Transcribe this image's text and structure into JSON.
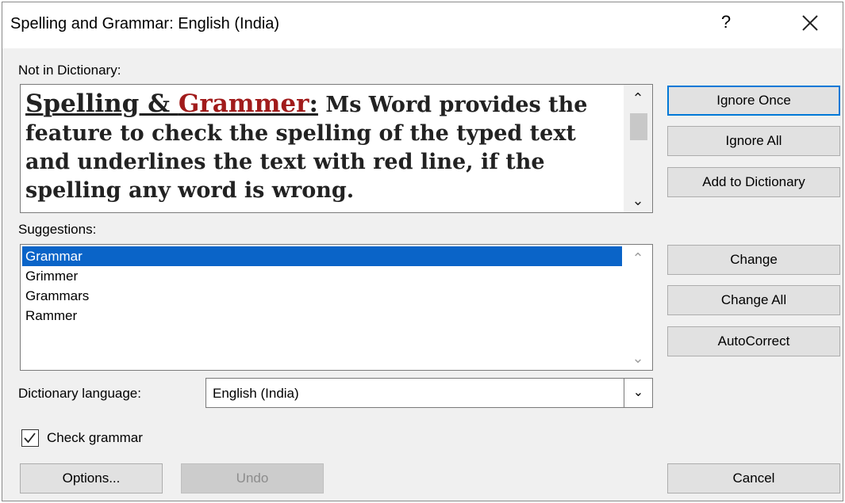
{
  "window": {
    "title": "Spelling and Grammar: English (India)",
    "help_glyph": "?",
    "close_icon": "close-icon"
  },
  "not_in_dictionary": {
    "label": "Not in Dictionary:",
    "heading_part1": "Spelling & ",
    "error_word": "Grammer",
    "heading_colon": ":",
    "text": " Ms Word provides the feature to check the spelling of the typed text and underlines the text with red line, if the spelling any word is wrong.",
    "error_color": "#a11b1b"
  },
  "suggestions": {
    "label": "Suggestions:",
    "items": [
      "Grammar",
      "Grimmer",
      "Grammars",
      "Rammer"
    ],
    "selected_index": 0,
    "selected_color": "#0a64c8"
  },
  "dictionary_language": {
    "label": "Dictionary language:",
    "value": "English (India)"
  },
  "check_grammar": {
    "label": "Check grammar",
    "checked": true
  },
  "buttons": {
    "ignore_once": "Ignore Once",
    "ignore_all": "Ignore All",
    "add_to_dictionary": "Add to Dictionary",
    "change": "Change",
    "change_all": "Change All",
    "autocorrect": "AutoCorrect",
    "options": "Options...",
    "undo": "Undo",
    "cancel": "Cancel"
  },
  "accent_color": "#0078d7"
}
